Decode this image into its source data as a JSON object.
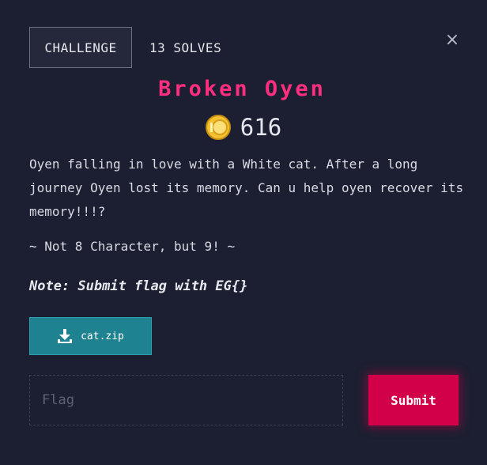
{
  "tabs": {
    "challenge_label": "CHALLENGE",
    "solves_label": "13 SOLVES"
  },
  "close_glyph": "×",
  "challenge": {
    "title": "Broken Oyen",
    "points": "616",
    "description": "Oyen falling in love with a White cat. After a long journey Oyen lost its memory. Can u help oyen recover its memory!!!?",
    "hint": "~ Not 8 Character, but 9! ~",
    "note": "Note: Submit flag with EG{}"
  },
  "file": {
    "name": "cat.zip",
    "icon": "download-icon"
  },
  "flag_form": {
    "placeholder": "Flag",
    "value": "",
    "submit_label": "Submit"
  },
  "colors": {
    "background": "#1b1f31",
    "title": "#ff2e7e",
    "file_button": "#1e8290",
    "submit_button": "#d10048",
    "coin": "#f2c230"
  }
}
